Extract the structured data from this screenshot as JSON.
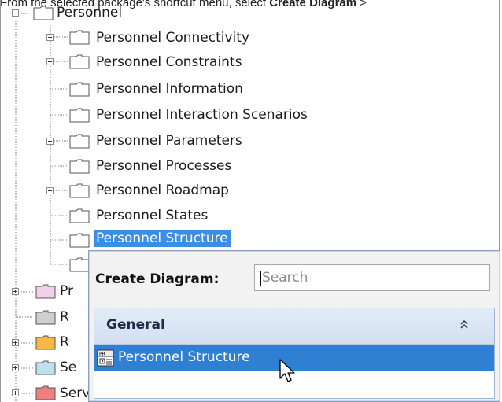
{
  "caption": {
    "prefix": "From the selected package's shortcut menu, select ",
    "bold": "Create Diagram",
    "suffix": " > "
  },
  "tree": {
    "root_label": "Personnel",
    "children": [
      {
        "label": "Personnel Connectivity",
        "expandable": true
      },
      {
        "label": "Personnel Constraints",
        "expandable": true
      },
      {
        "label": "Personnel Information",
        "expandable": false
      },
      {
        "label": "Personnel Interaction Scenarios",
        "expandable": false
      },
      {
        "label": "Personnel Parameters",
        "expandable": true
      },
      {
        "label": "Personnel Processes",
        "expandable": false
      },
      {
        "label": "Personnel Roadmap",
        "expandable": true
      },
      {
        "label": "Personnel States",
        "expandable": false
      },
      {
        "label": "Personnel Structure",
        "expandable": false,
        "selected": true
      }
    ],
    "siblings": [
      {
        "label": "Pr",
        "color": "#f4cfe8"
      },
      {
        "label": "R",
        "color": "#cfcfcf"
      },
      {
        "label": "R",
        "color": "#f7b84a"
      },
      {
        "label": "Se",
        "color": "#bde0f0"
      },
      {
        "label": "Services",
        "color": "#f08080"
      }
    ]
  },
  "popup": {
    "create_diagram_label": "Create Diagram:",
    "search_placeholder": "Search",
    "group_title": "General",
    "item_label": "Personnel Structure",
    "colors": {
      "selection": "#2f7fd3",
      "header": "#d9e4f3"
    }
  }
}
